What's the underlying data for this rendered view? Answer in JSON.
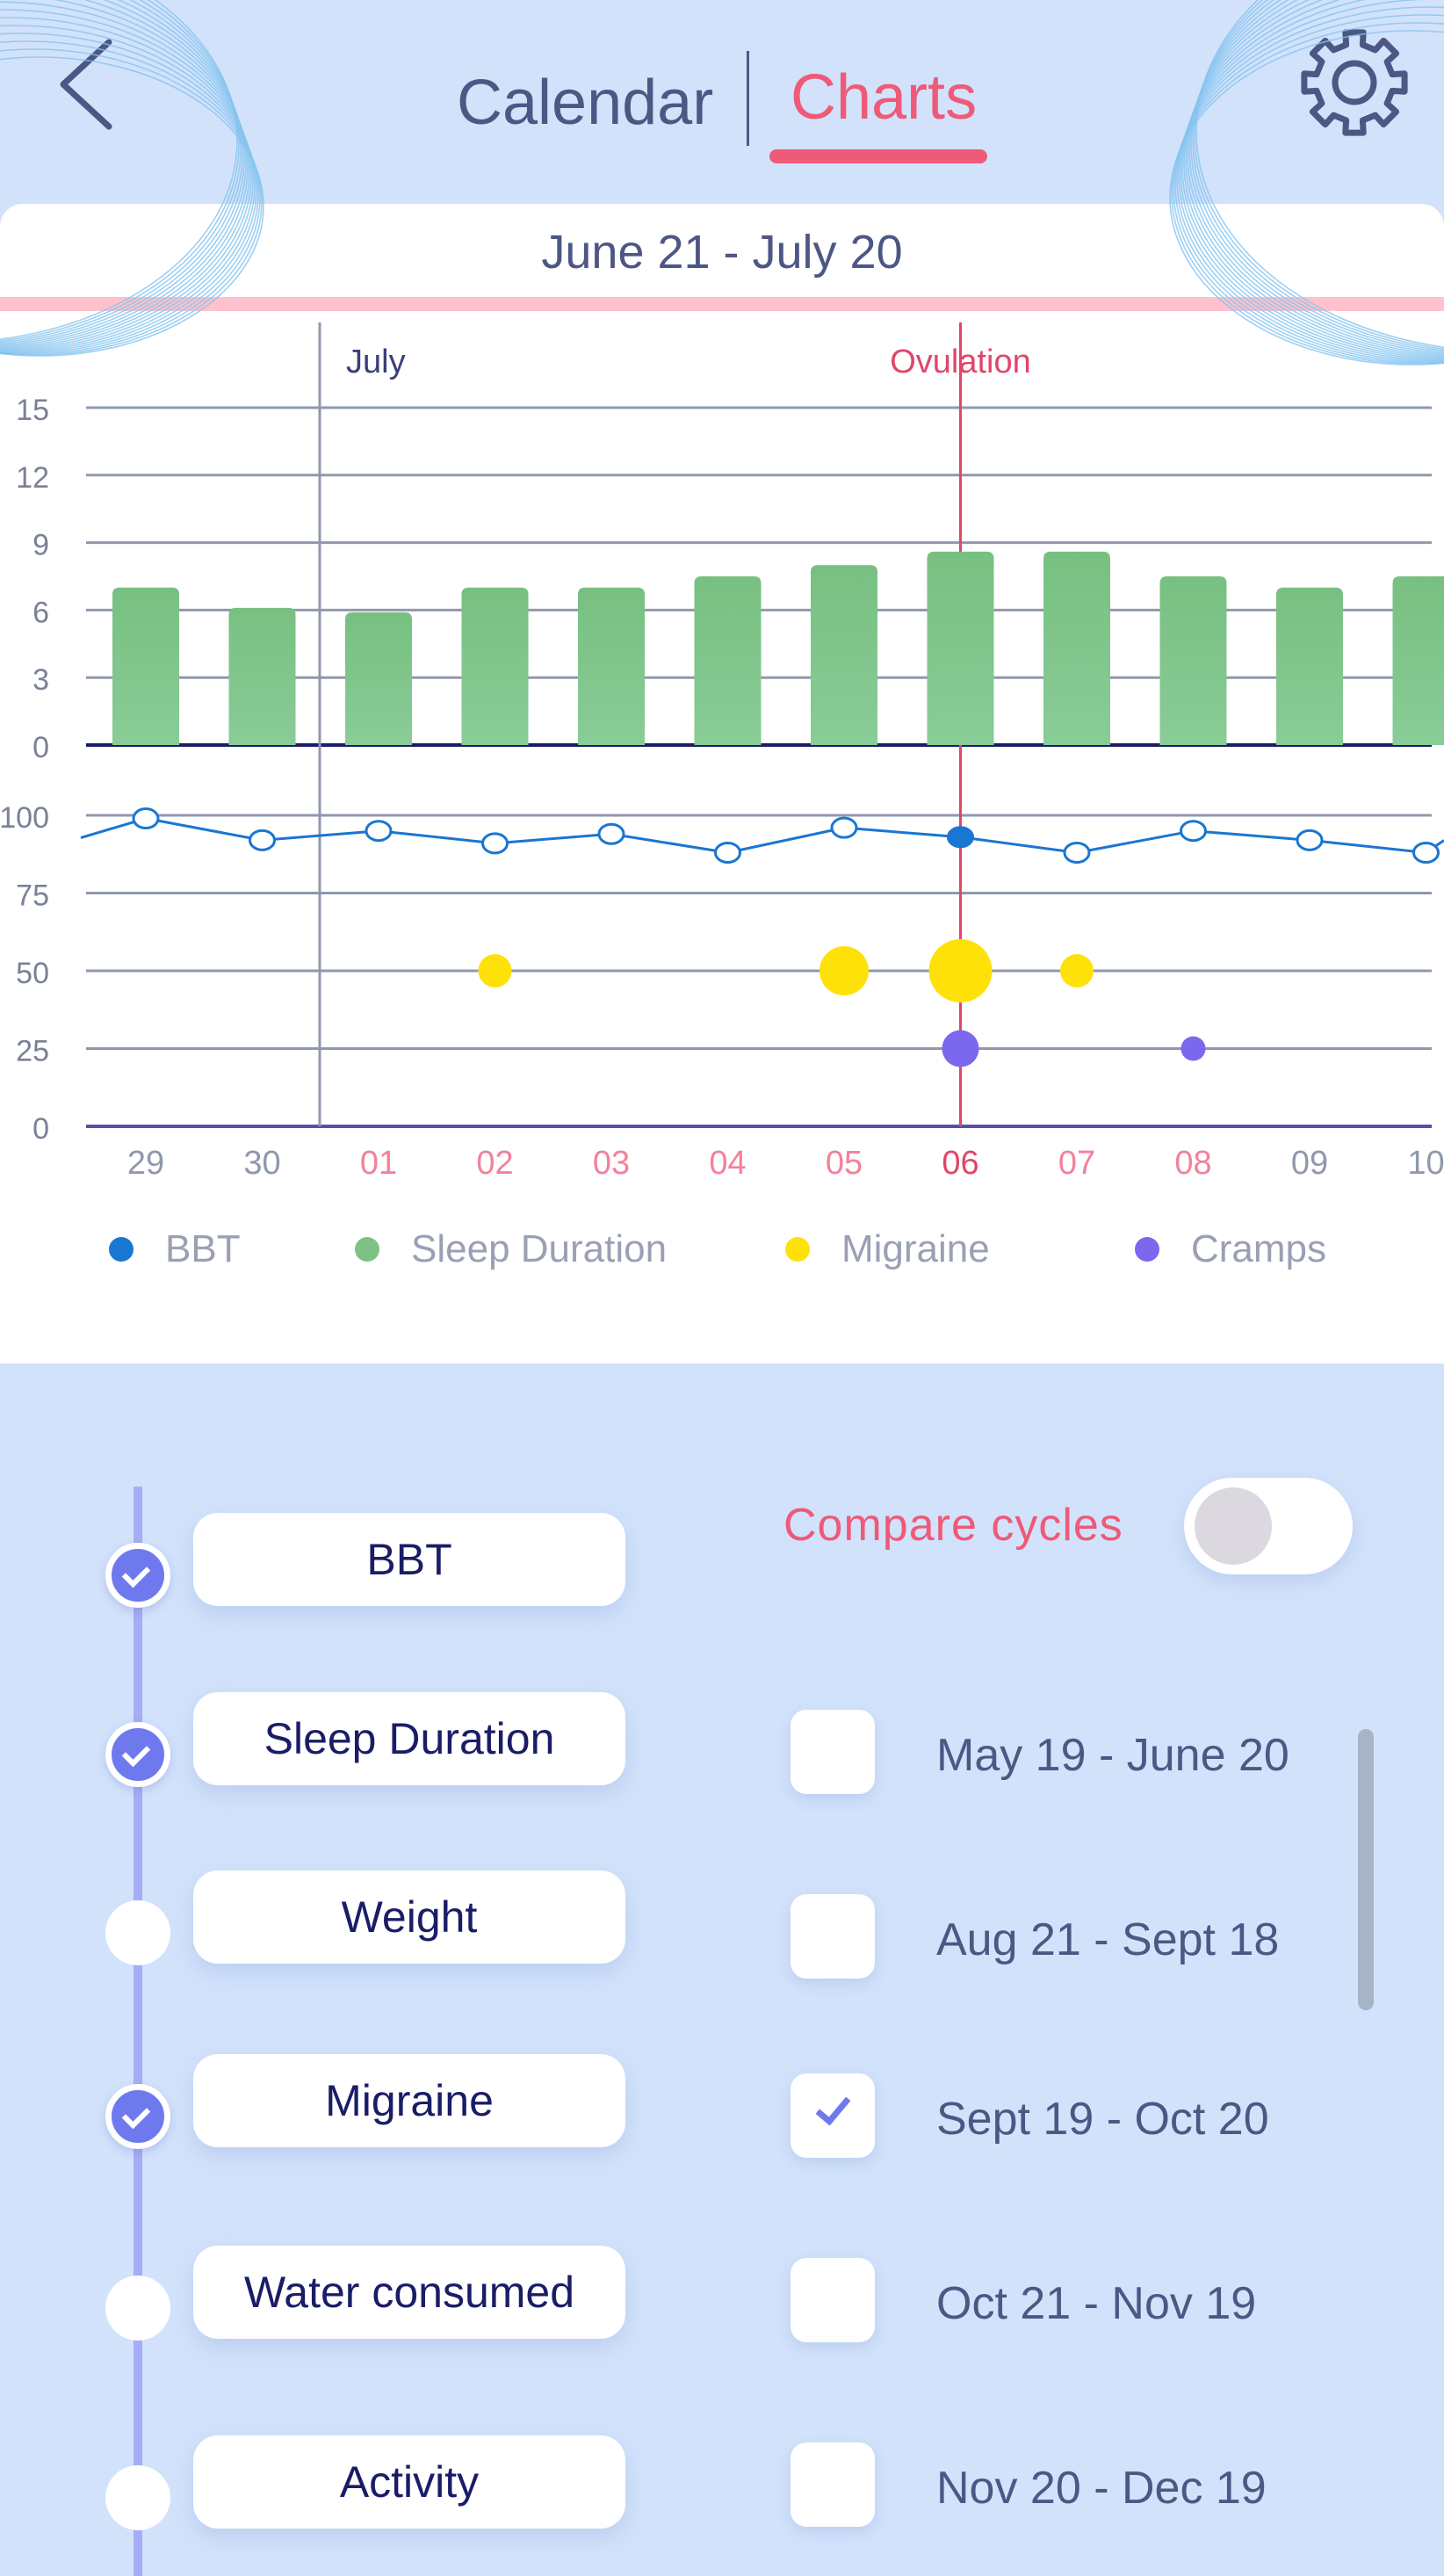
{
  "header": {
    "back_icon": "chevron-left-icon",
    "tabs": [
      {
        "label": "Calendar",
        "active": false
      },
      {
        "label": "Charts",
        "active": true
      }
    ],
    "settings_icon": "gear-icon",
    "colors": {
      "active_tab": "#ee5a78",
      "inactive_tab": "#4d5784"
    }
  },
  "chart_card": {
    "date_range": "June 21 - July 20"
  },
  "chart_data": {
    "type": "bar",
    "x_labels": [
      "29",
      "30",
      "01",
      "02",
      "03",
      "04",
      "05",
      "06",
      "07",
      "08",
      "09",
      "10"
    ],
    "highlighted_x": [
      "01",
      "02",
      "03",
      "04",
      "05",
      "07",
      "08"
    ],
    "selected_x": "06",
    "annotations": [
      {
        "label": "July",
        "at": "01"
      },
      {
        "label": "Ovulation",
        "at": "06"
      }
    ],
    "sleep_panel": {
      "y_ticks": [
        "15",
        "12",
        "9",
        "6",
        "3",
        "0"
      ],
      "ylim": [
        0,
        15
      ],
      "series": [
        {
          "name": "Sleep Duration",
          "type": "bar",
          "color": "#7cc285",
          "values": [
            7.0,
            6.1,
            5.9,
            7.0,
            7.0,
            7.5,
            8.0,
            8.6,
            8.6,
            7.5,
            7.0,
            7.5
          ]
        }
      ]
    },
    "symptom_panel": {
      "y_ticks": [
        "100",
        "75",
        "50",
        "25",
        "0"
      ],
      "ylim": [
        0,
        100
      ],
      "series": [
        {
          "name": "BBT",
          "type": "line",
          "color": "#1976d2",
          "values": [
            99,
            92,
            95,
            91,
            94,
            88,
            96,
            93,
            88,
            95,
            92,
            88
          ]
        },
        {
          "name": "Migraine",
          "type": "scatter",
          "color": "#ffe10a",
          "points": [
            {
              "x": "02",
              "y": 50,
              "size": 1
            },
            {
              "x": "05",
              "y": 50,
              "size": 2
            },
            {
              "x": "06",
              "y": 50,
              "size": 3
            },
            {
              "x": "07",
              "y": 50,
              "size": 1
            }
          ]
        },
        {
          "name": "Cramps",
          "type": "scatter",
          "color": "#7b68ee",
          "points": [
            {
              "x": "06",
              "y": 25,
              "size": 2
            },
            {
              "x": "08",
              "y": 25,
              "size": 1
            }
          ]
        }
      ]
    },
    "legend": [
      {
        "label": "BBT",
        "color": "#1976d2"
      },
      {
        "label": "Sleep Duration",
        "color": "#7cc285"
      },
      {
        "label": "Migraine",
        "color": "#ffe10a"
      },
      {
        "label": "Cramps",
        "color": "#7b68ee"
      }
    ]
  },
  "metrics": [
    {
      "label": "BBT",
      "checked": true
    },
    {
      "label": "Sleep Duration",
      "checked": true
    },
    {
      "label": "Weight",
      "checked": false
    },
    {
      "label": "Migraine",
      "checked": true
    },
    {
      "label": "Water consumed",
      "checked": false
    },
    {
      "label": "Activity",
      "checked": false
    }
  ],
  "compare": {
    "label": "Compare cycles",
    "enabled": false,
    "cycles": [
      {
        "label": "May 19 - June 20",
        "checked": false
      },
      {
        "label": "Aug 21 - Sept 18",
        "checked": false
      },
      {
        "label": "Sept 19 - Oct 20",
        "checked": true
      },
      {
        "label": "Oct 21 - Nov 19",
        "checked": false
      },
      {
        "label": "Nov 20 - Dec 19",
        "checked": false
      }
    ]
  }
}
